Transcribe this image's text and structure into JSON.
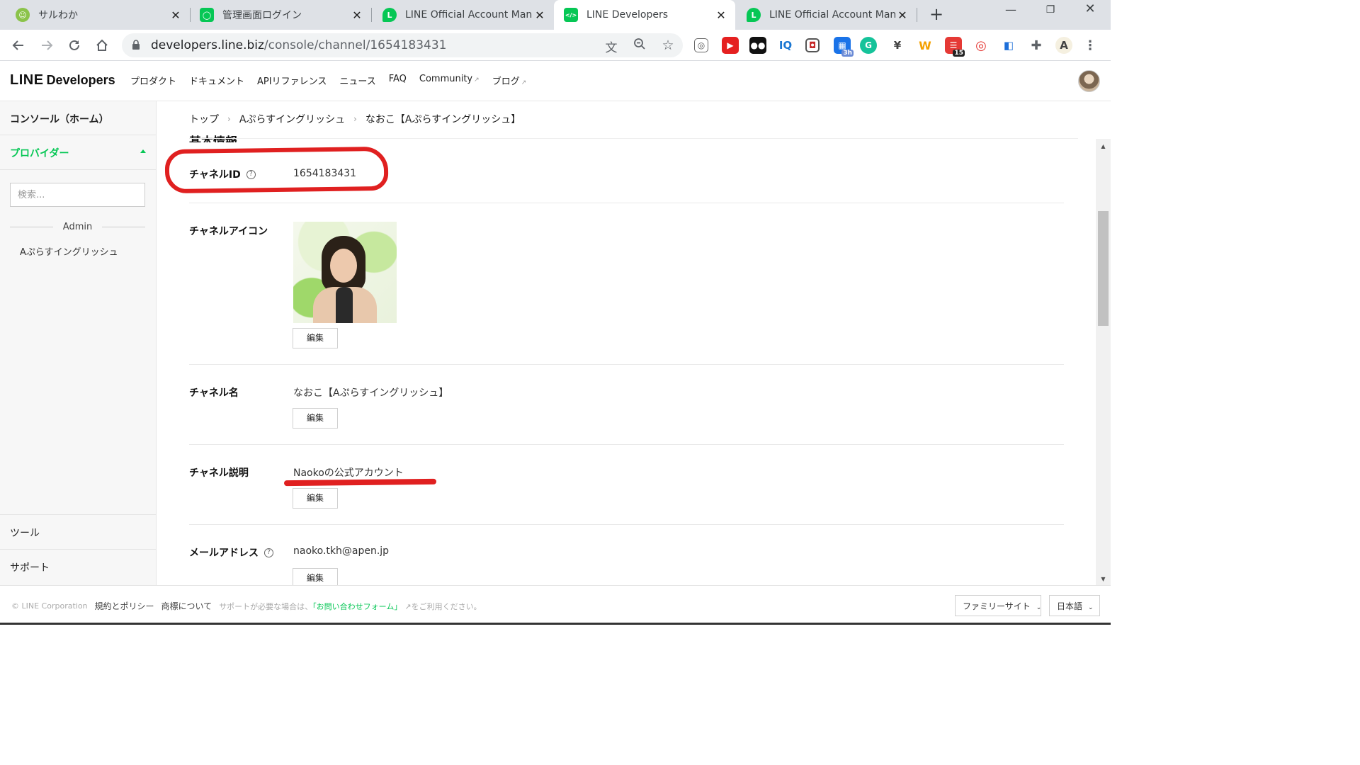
{
  "browser": {
    "tabs": [
      {
        "title": "サルわか",
        "favicon_color": "#7cb342",
        "favicon_glyph": "☺",
        "active": false
      },
      {
        "title": "管理画面ログイン",
        "favicon_color": "#06c755",
        "favicon_glyph": "◯",
        "active": false
      },
      {
        "title": "LINE Official Account Mana",
        "favicon_color": "#06c755",
        "favicon_glyph": "L",
        "active": false
      },
      {
        "title": "LINE Developers",
        "favicon_color": "#06c755",
        "favicon_glyph": "</>",
        "active": true
      },
      {
        "title": "LINE Official Account Mana",
        "favicon_color": "#06c755",
        "favicon_glyph": "L",
        "active": false
      }
    ],
    "url_host": "developers.line.biz",
    "url_path": "/console/channel/1654183431",
    "extension_badges": {
      "calendar": "3h",
      "todo": "15"
    }
  },
  "header": {
    "logo_main": "LINE",
    "logo_sub": "Developers",
    "nav": [
      "プロダクト",
      "ドキュメント",
      "APIリファレンス",
      "ニュース",
      "FAQ",
      "Community",
      "ブログ"
    ]
  },
  "sidebar": {
    "home": "コンソール（ホーム）",
    "providers": "プロバイダー",
    "search_placeholder": "検索...",
    "group": "Admin",
    "item": "Aぷらすイングリッシュ",
    "tools": "ツール",
    "support": "サポート"
  },
  "breadcrumb": [
    "トップ",
    "Aぷらすイングリッシュ",
    "なおこ【Aぷらすイングリッシュ】"
  ],
  "section_title": "基本情報",
  "fields": {
    "channel_id": {
      "label": "チャネルID",
      "value": "1654183431"
    },
    "channel_icon": {
      "label": "チャネルアイコン"
    },
    "channel_name": {
      "label": "チャネル名",
      "value": "なおこ【Aぷらすイングリッシュ】"
    },
    "channel_desc": {
      "label": "チャネル説明",
      "value": "Naokoの公式アカウント"
    },
    "email": {
      "label": "メールアドレス",
      "value": "naoko.tkh@apen.jp"
    }
  },
  "edit_label": "編集",
  "footer": {
    "copyright": "© LINE Corporation",
    "terms": "規約とポリシー",
    "trademark": "商標について",
    "support_prefix": "サポートが必要な場合は、",
    "support_link": "「お問い合わせフォーム」",
    "support_suffix": "をご利用ください。",
    "family_sites": "ファミリーサイト",
    "language": "日本語"
  },
  "colors": {
    "brand_green": "#06c755",
    "annotation_red": "#e02020"
  }
}
